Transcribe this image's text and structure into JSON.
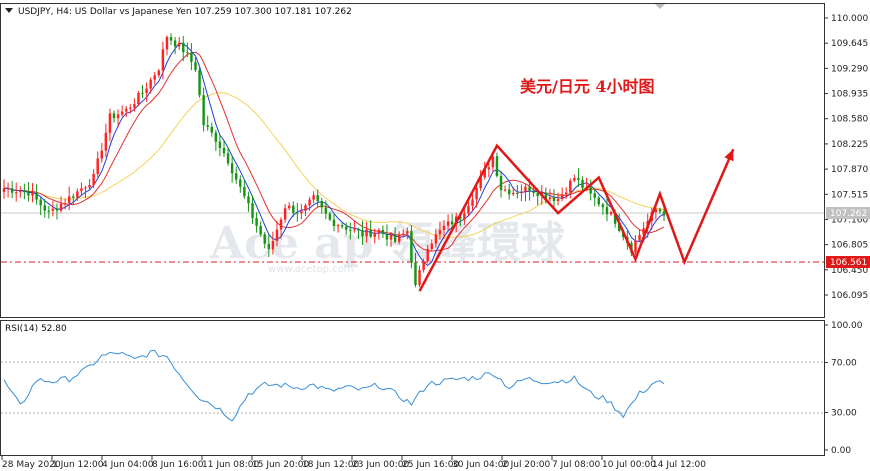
{
  "header": {
    "symbol_line": "USDJPY, H4:  US Dollar vs Japanese Yen  107.259 107.300 107.181 107.262"
  },
  "annotation": {
    "text": "美元/日元 4小时图"
  },
  "watermark": {
    "text": "Ace  ap 領峰環球",
    "url": "www.acetop.com"
  },
  "colors": {
    "up": "#ff2222",
    "down": "#159515",
    "ma_fast": "#1f3fdf",
    "ma_mid": "#e33030",
    "ma_slow": "#f2d35a",
    "rsi": "#3a8fd6",
    "arrow": "#e01818",
    "level": "#e01818"
  },
  "price_axis": {
    "ticks": [
      "110.000",
      "109.645",
      "109.290",
      "108.935",
      "108.580",
      "108.225",
      "107.870",
      "107.515",
      "107.160",
      "106.805",
      "106.450",
      "106.095"
    ],
    "current_price": "107.262",
    "level_price": "106.561"
  },
  "rsi_panel": {
    "label": "RSI(14) 52.80",
    "ticks": [
      "100.00",
      "70.00",
      "30.00",
      "0.00"
    ]
  },
  "time_axis": {
    "ticks": [
      "28 May 2020",
      "1 Jun 12:00",
      "4 Jun 04:00",
      "8 Jun 16:00",
      "11 Jun 08:00",
      "15 Jun 20:00",
      "18 Jun 12:00",
      "23 Jun 00:00",
      "25 Jun 16:00",
      "30 Jun 04:00",
      "2 Jul 20:00",
      "7 Jul 08:00",
      "10 Jul 00:00",
      "14 Jul 12:00"
    ]
  },
  "chart_data": {
    "type": "candlestick",
    "symbol": "USDJPY",
    "timeframe": "H4",
    "ohlc_last": {
      "open": 107.259,
      "high": 107.3,
      "low": 107.181,
      "close": 107.262
    },
    "ylim": [
      105.95,
      110.15
    ],
    "rsi_ylim": [
      0,
      100
    ],
    "rsi_levels": [
      70,
      30
    ],
    "rsi_last": 52.8,
    "level_price": 106.561,
    "candle_path": [
      [
        0,
        107.6
      ],
      [
        6,
        107.55
      ],
      [
        11,
        107.25
      ],
      [
        18,
        107.55
      ],
      [
        22,
        107.75
      ],
      [
        26,
        108.6
      ],
      [
        30,
        108.7
      ],
      [
        34,
        108.95
      ],
      [
        38,
        109.3
      ],
      [
        40,
        109.75
      ],
      [
        44,
        109.55
      ],
      [
        47,
        109.3
      ],
      [
        49,
        108.5
      ],
      [
        52,
        108.3
      ],
      [
        55,
        108.0
      ],
      [
        58,
        107.6
      ],
      [
        61,
        107.2
      ],
      [
        65,
        106.7
      ],
      [
        69,
        107.35
      ],
      [
        73,
        107.25
      ],
      [
        76,
        107.45
      ],
      [
        80,
        107.15
      ],
      [
        84,
        107.05
      ],
      [
        88,
        106.95
      ],
      [
        92,
        107.0
      ],
      [
        96,
        106.85
      ],
      [
        99,
        107.0
      ],
      [
        101,
        106.2
      ],
      [
        104,
        106.8
      ],
      [
        108,
        107.05
      ],
      [
        112,
        107.2
      ],
      [
        116,
        107.6
      ],
      [
        120,
        108.05
      ],
      [
        122,
        107.6
      ],
      [
        125,
        107.55
      ],
      [
        129,
        107.6
      ],
      [
        133,
        107.5
      ],
      [
        136,
        107.45
      ],
      [
        140,
        107.75
      ],
      [
        144,
        107.5
      ],
      [
        147,
        107.35
      ],
      [
        150,
        107.15
      ],
      [
        154,
        106.75
      ],
      [
        157,
        107.05
      ],
      [
        160,
        107.3
      ],
      [
        162,
        107.262
      ]
    ],
    "rsi_path": [
      [
        0,
        55
      ],
      [
        4,
        35
      ],
      [
        8,
        56
      ],
      [
        12,
        55
      ],
      [
        16,
        57
      ],
      [
        20,
        64
      ],
      [
        24,
        75
      ],
      [
        28,
        78
      ],
      [
        32,
        72
      ],
      [
        36,
        78
      ],
      [
        40,
        75
      ],
      [
        44,
        57
      ],
      [
        48,
        42
      ],
      [
        52,
        35
      ],
      [
        56,
        25
      ],
      [
        60,
        45
      ],
      [
        64,
        52
      ],
      [
        68,
        52
      ],
      [
        72,
        50
      ],
      [
        76,
        52
      ],
      [
        80,
        47
      ],
      [
        84,
        50
      ],
      [
        88,
        48
      ],
      [
        92,
        52
      ],
      [
        96,
        45
      ],
      [
        100,
        37
      ],
      [
        104,
        53
      ],
      [
        108,
        55
      ],
      [
        112,
        57
      ],
      [
        116,
        58
      ],
      [
        120,
        62
      ],
      [
        124,
        50
      ],
      [
        128,
        57
      ],
      [
        132,
        55
      ],
      [
        136,
        55
      ],
      [
        140,
        57
      ],
      [
        144,
        45
      ],
      [
        148,
        40
      ],
      [
        152,
        28
      ],
      [
        156,
        45
      ],
      [
        160,
        55
      ],
      [
        162,
        52.8
      ]
    ],
    "projection_path": [
      [
        102,
        106.15
      ],
      [
        121,
        108.2
      ],
      [
        136,
        107.25
      ],
      [
        146,
        107.75
      ],
      [
        155,
        106.6
      ],
      [
        161,
        107.52
      ],
      [
        167,
        106.56
      ],
      [
        179,
        108.15
      ]
    ]
  }
}
